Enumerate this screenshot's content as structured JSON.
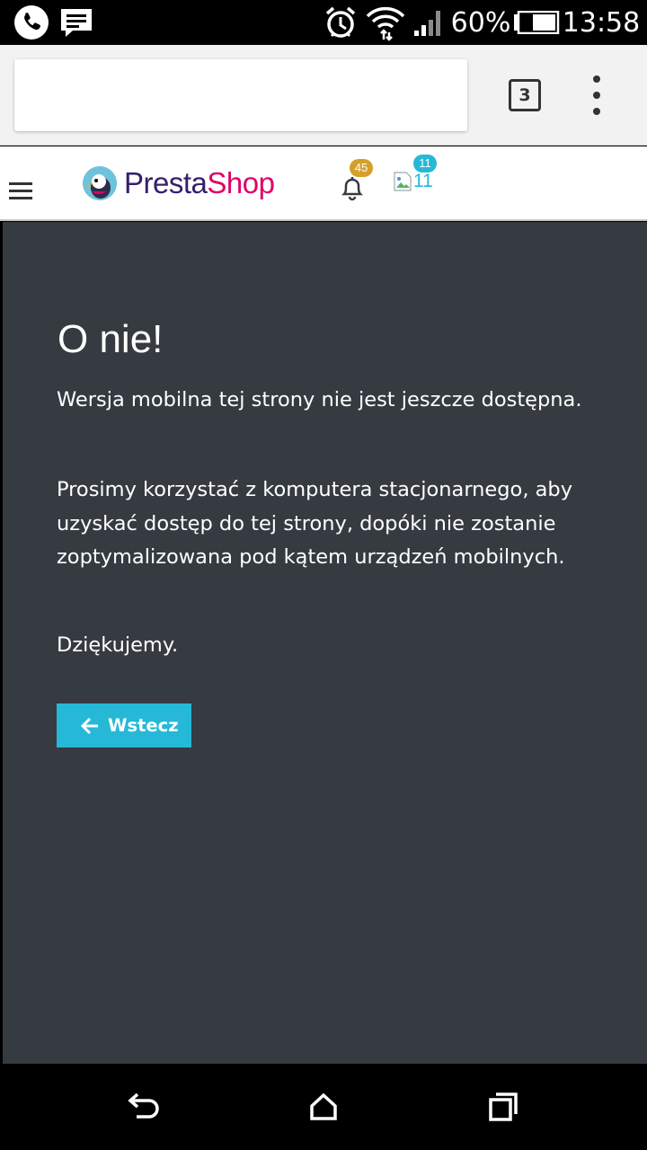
{
  "status_bar": {
    "battery_percent": "60%",
    "time": "13:58",
    "icons": [
      "phone-icon",
      "message-icon",
      "alarm-icon",
      "wifi-icon",
      "signal-icon",
      "battery-icon"
    ]
  },
  "browser": {
    "url": "",
    "tab_count": "3"
  },
  "header": {
    "logo_part1": "Presta",
    "logo_part2": "Shop",
    "notifications_count": "45",
    "messages_count": "11",
    "broken_image_alt": "11"
  },
  "content": {
    "title": "O nie!",
    "paragraph1": "Wersja mobilna tej strony nie jest jeszcze dostępna.",
    "paragraph2": "Prosimy korzystać z komputera stacjonarnego, aby uzyskać dostęp do tej strony, dopóki nie zostanie zoptymalizowana pod kątem urządzeń mobilnych.",
    "paragraph3": "Dziękujemy.",
    "back_button": "Wstecz"
  },
  "colors": {
    "content_bg": "#363a41",
    "accent": "#25b9d7",
    "badge_orange": "#d5a02a",
    "logo_purple": "#34206b",
    "logo_pink": "#df0067"
  }
}
